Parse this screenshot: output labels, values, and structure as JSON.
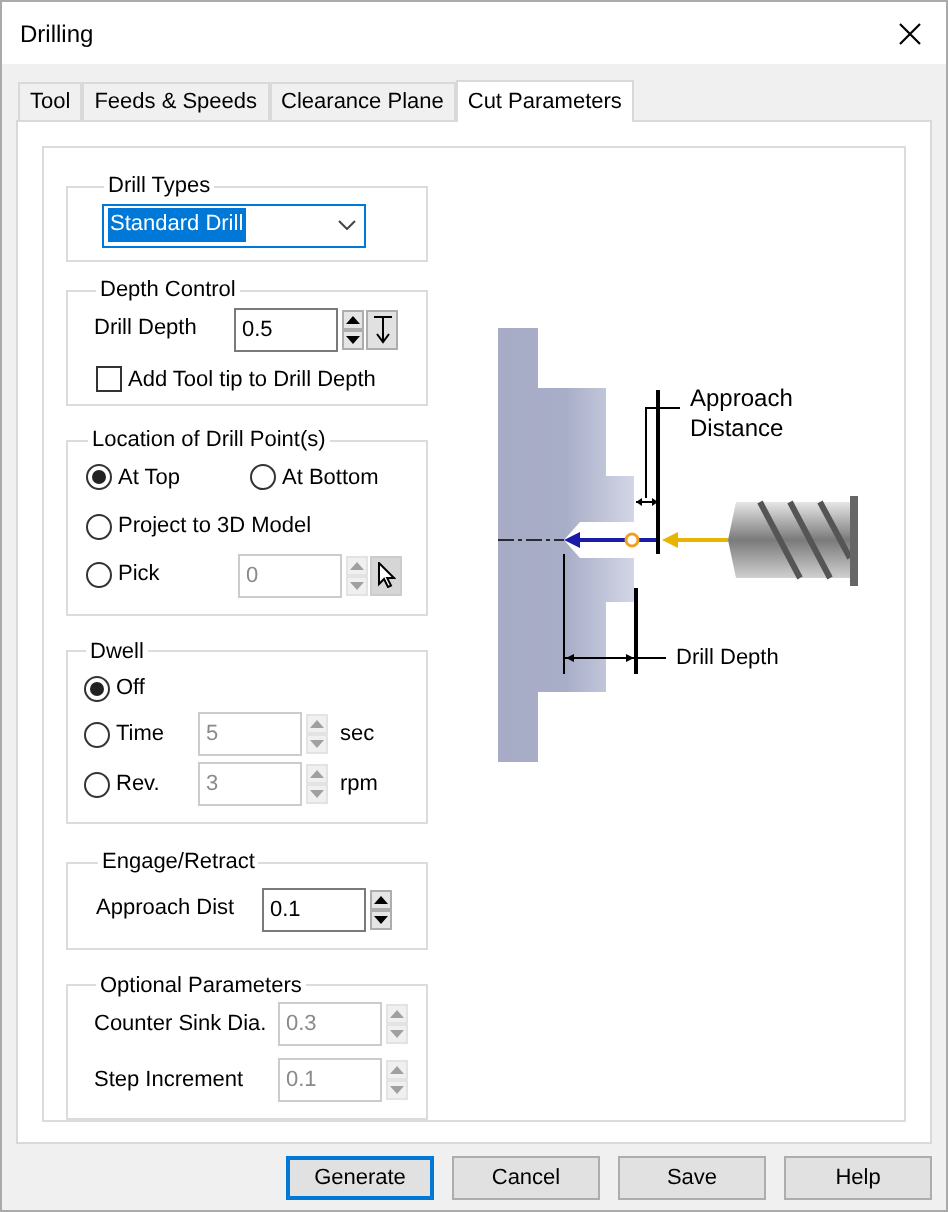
{
  "window": {
    "title": "Drilling"
  },
  "tabs": [
    {
      "label": "Tool",
      "selected": false
    },
    {
      "label": "Feeds & Speeds",
      "selected": false
    },
    {
      "label": "Clearance Plane",
      "selected": false
    },
    {
      "label": "Cut Parameters",
      "selected": true
    }
  ],
  "drill_types": {
    "label": "Drill Types",
    "value": "Standard Drill"
  },
  "depth_control": {
    "label": "Depth Control",
    "drill_depth": {
      "label": "Drill Depth",
      "value": "0.5"
    },
    "add_tool_tip": {
      "label": "Add Tool tip to Drill Depth",
      "checked": false
    }
  },
  "location": {
    "label": "Location of Drill Point(s)",
    "options": [
      {
        "label": "At Top",
        "selected": true
      },
      {
        "label": "At Bottom",
        "selected": false
      },
      {
        "label": "Project to 3D Model",
        "selected": false
      },
      {
        "label": "Pick",
        "selected": false
      }
    ],
    "pick_field": {
      "value": "0",
      "disabled": true
    }
  },
  "dwell": {
    "label": "Dwell",
    "options": [
      {
        "label": "Off",
        "selected": true
      },
      {
        "label": "Time",
        "selected": false,
        "value": "5",
        "unit": "sec",
        "disabled": true
      },
      {
        "label": "Rev.",
        "selected": false,
        "value": "3",
        "unit": "rpm",
        "disabled": true
      }
    ]
  },
  "engage_retract": {
    "label": "Engage/Retract",
    "approach_dist": {
      "label": "Approach Dist",
      "value": "0.1"
    }
  },
  "optional_parameters": {
    "label": "Optional Parameters",
    "fields": [
      {
        "label": "Counter Sink Dia.",
        "value": "0.3",
        "disabled": true
      },
      {
        "label": "Step Increment",
        "value": "0.1",
        "disabled": true
      }
    ]
  },
  "diagram": {
    "approach_label": "Approach Distance",
    "depth_label": "Drill Depth"
  },
  "buttons": [
    {
      "label": "Generate",
      "focused": true
    },
    {
      "label": "Cancel",
      "focused": false
    },
    {
      "label": "Save",
      "focused": false
    },
    {
      "label": "Help",
      "focused": false
    }
  ]
}
